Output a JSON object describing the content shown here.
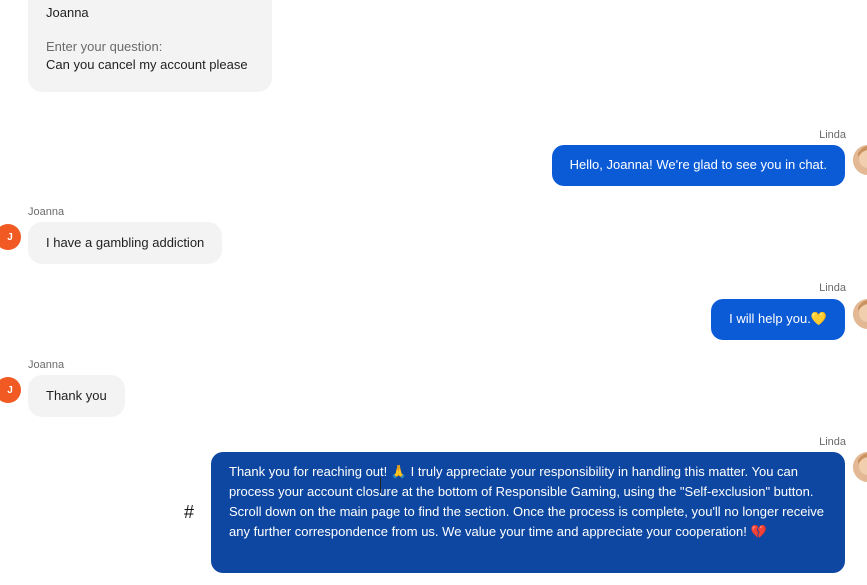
{
  "messages": {
    "intro": {
      "name_value": "Joanna",
      "question_label": "Enter your question:",
      "question_value": "Can you cancel my account please"
    },
    "m1": {
      "sender": "Linda",
      "text": "Hello, Joanna! We're glad to see you in chat."
    },
    "m2": {
      "sender": "Joanna",
      "avatar_letter": "J",
      "text": "I have a gambling addiction"
    },
    "m3": {
      "sender": "Linda",
      "text": "I will help you.",
      "emoji": "💛"
    },
    "m4": {
      "sender": "Joanna",
      "avatar_letter": "J",
      "text": "Thank you"
    },
    "m5": {
      "sender": "Linda",
      "text": "Thank you for reaching out! 🙏 I truly appreciate your responsibility in handling this matter. You can process your account closure at the bottom of Responsible Gaming, using the \"Self-exclusion\" button. Scroll down on the main page to find the section. Once the process is complete, you'll no longer receive any further correspondence from us. We value your time and appreciate your cooperation! 💔"
    }
  },
  "misc": {
    "hash_symbol": "#"
  },
  "colors": {
    "agent_bubble": "#0b5bd7",
    "agent_bubble_dark": "#0d47a1",
    "user_bubble": "#f3f3f3",
    "user_avatar": "#f15a22"
  },
  "icons": {
    "agent_avatar": "avatar-photo-icon",
    "user_avatar": "letter-avatar-icon"
  }
}
